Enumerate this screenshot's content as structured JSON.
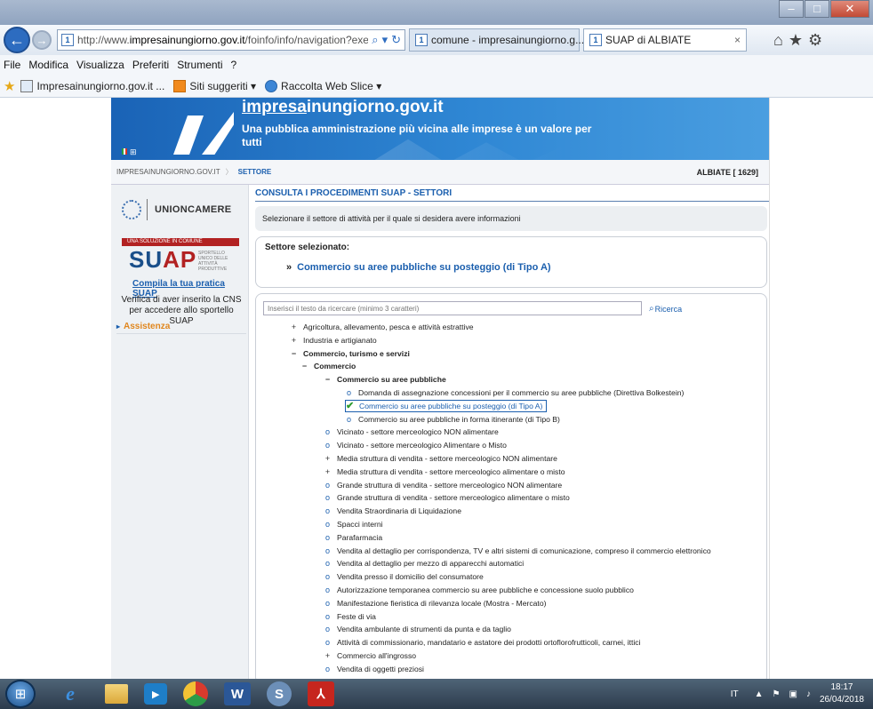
{
  "browser": {
    "address_url_prefix": "http://www.",
    "address_url_domain": "impresainungiorno.gov.it",
    "address_url_suffix": "/foinfo/info/navigation?exec",
    "tabs": [
      {
        "label": "comune - impresainungiorno.g..."
      },
      {
        "label": "SUAP di ALBIATE"
      }
    ],
    "menu": [
      "File",
      "Modifica",
      "Visualizza",
      "Preferiti",
      "Strumenti",
      "?"
    ],
    "favorites": [
      {
        "label": "Impresainungiorno.gov.it ..."
      },
      {
        "label": "Siti suggeriti ▾"
      },
      {
        "label": "Raccolta Web Slice ▾"
      }
    ]
  },
  "site": {
    "name_part1": "impresa",
    "name_part2": "inungiorno.gov.it",
    "tagline": "Una pubblica amministrazione più vicina alle imprese è un valore per tutti",
    "breadcrumb": [
      "IMPRESAINUNGIORNO.GOV.IT",
      "SETTORE"
    ],
    "comune": "ALBIATE [ 1629]"
  },
  "sidebar": {
    "unioncamere": "UNIONCAMERE",
    "suap_strip": "UNA SOLUZIONE IN COMUNE",
    "suap_word_a": "SU",
    "suap_word_b": "AP",
    "suap_small": "SPORTELLO UNICO DELLE ATTIVITÀ PRODUTTIVE",
    "compila": "Compila la tua pratica SUAP",
    "verifica": "Verifica di aver inserito la CNS per accedere allo sportello SUAP",
    "assistenza": "Assistenza"
  },
  "main": {
    "heading": "CONSULTA I PROCEDIMENTI SUAP - SETTORI",
    "instruction": "Selezionare il settore di attività per il quale si desidera avere informazioni",
    "selected_title": "Settore selezionato:",
    "selected_marker": "»",
    "selected_value": "Commercio su aree pubbliche su posteggio (di Tipo A)",
    "search_placeholder": "Inserisci il testo da ricercare (minimo 3 caratteri)",
    "search_button": "Ricerca"
  },
  "tree": [
    {
      "sym": "+",
      "label": "Agricoltura, allevamento, pesca e attività estrattive",
      "level": 0
    },
    {
      "sym": "+",
      "label": "Industria e artigianato",
      "level": 0
    },
    {
      "sym": "−",
      "label": "Commercio, turismo e servizi",
      "level": 0,
      "bold": true
    },
    {
      "sym": "−",
      "label": "Commercio",
      "level": 1,
      "bold": true
    },
    {
      "sym": "−",
      "label": "Commercio su aree pubbliche",
      "level": 2,
      "bold": true
    },
    {
      "sym": "o",
      "label": "Domanda di assegnazione concessioni per il commercio su aree pubbliche (Direttiva Bolkestein)",
      "level": 3
    },
    {
      "sym": "✔",
      "label": "Commercio su aree pubbliche su posteggio (di Tipo A)",
      "level": 3,
      "selected": true
    },
    {
      "sym": "o",
      "label": "Commercio su aree pubbliche in forma itinerante (di Tipo B)",
      "level": 3
    },
    {
      "sym": "o",
      "label": "Vicinato - settore merceologico NON alimentare",
      "level": 2
    },
    {
      "sym": "o",
      "label": "Vicinato - settore merceologico Alimentare o Misto",
      "level": 2
    },
    {
      "sym": "+",
      "label": "Media struttura di vendita - settore merceologico NON alimentare",
      "level": 2
    },
    {
      "sym": "+",
      "label": "Media struttura di vendita - settore merceologico alimentare o misto",
      "level": 2
    },
    {
      "sym": "o",
      "label": "Grande struttura di vendita - settore merceologico NON alimentare",
      "level": 2
    },
    {
      "sym": "o",
      "label": "Grande struttura di vendita - settore merceologico alimentare o misto",
      "level": 2
    },
    {
      "sym": "o",
      "label": "Vendita Straordinaria di Liquidazione",
      "level": 2
    },
    {
      "sym": "o",
      "label": "Spacci interni",
      "level": 2
    },
    {
      "sym": "o",
      "label": "Parafarmacia",
      "level": 2
    },
    {
      "sym": "o",
      "label": "Vendita al dettaglio per corrispondenza, TV e altri sistemi di comunicazione, compreso il commercio elettronico",
      "level": 2
    },
    {
      "sym": "o",
      "label": "Vendita al dettaglio per mezzo di apparecchi automatici",
      "level": 2
    },
    {
      "sym": "o",
      "label": "Vendita presso il domicilio del consumatore",
      "level": 2
    },
    {
      "sym": "o",
      "label": "Autorizzazione temporanea commercio su aree pubbliche e concessione suolo pubblico",
      "level": 2
    },
    {
      "sym": "o",
      "label": "Manifestazione fieristica di rilevanza locale (Mostra - Mercato)",
      "level": 2
    },
    {
      "sym": "o",
      "label": "Feste di via",
      "level": 2
    },
    {
      "sym": "o",
      "label": "Vendita ambulante di strumenti da punta e da taglio",
      "level": 2
    },
    {
      "sym": "o",
      "label": "Attività di commissionario, mandatario e astatore dei prodotti ortoflorofrutticoli, carnei, ittici",
      "level": 2
    },
    {
      "sym": "+",
      "label": "Commercio all'ingrosso",
      "level": 2
    },
    {
      "sym": "o",
      "label": "Vendita di oggetti preziosi",
      "level": 2
    }
  ],
  "taskbar": {
    "lang": "IT",
    "time": "18:17",
    "date": "26/04/2018"
  },
  "colors": {
    "brand_blue": "#1b5fae",
    "banner_blue": "#2f87d4",
    "accent_orange": "#e0861d",
    "check_green": "#2e9b2e"
  }
}
